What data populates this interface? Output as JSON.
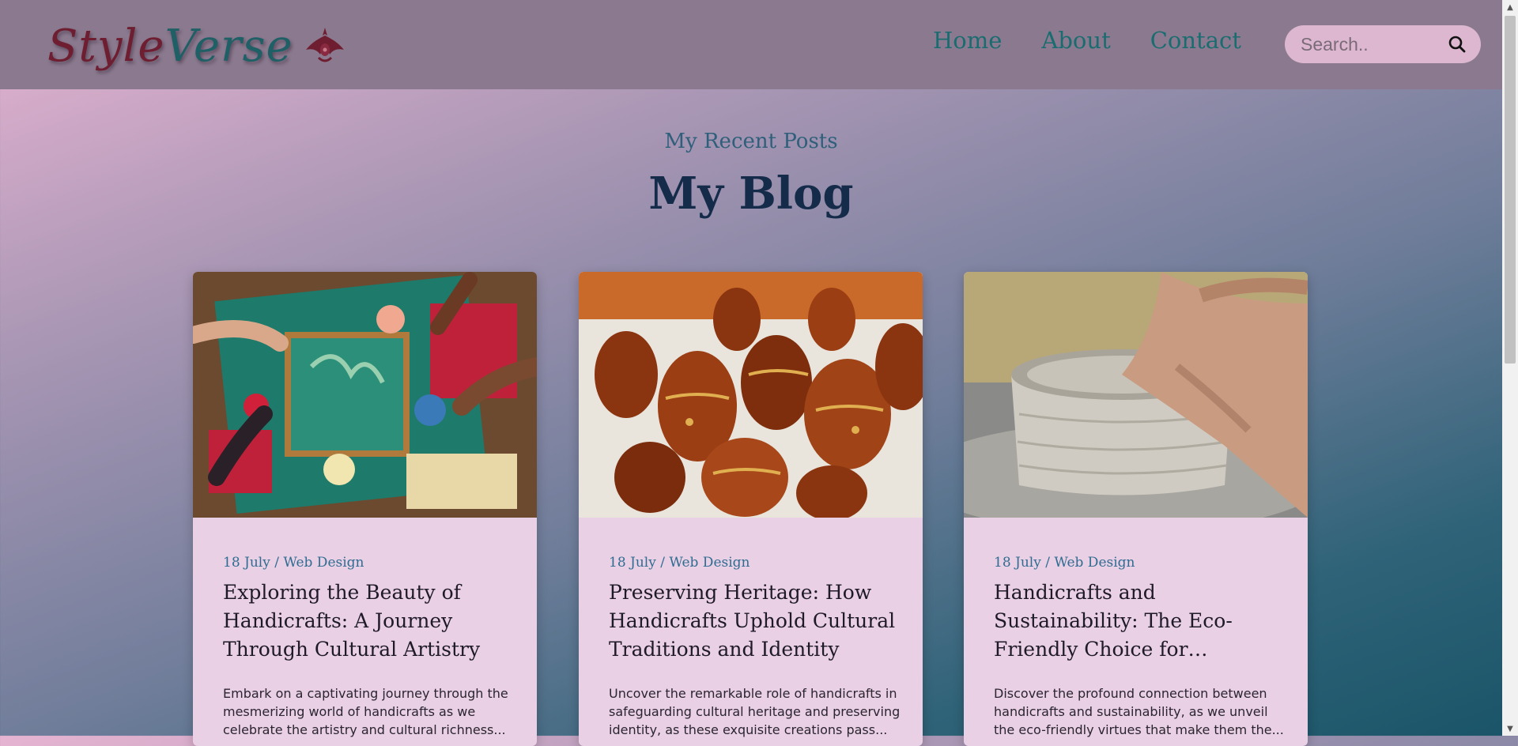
{
  "brand": {
    "logo_part1": "Style",
    "logo_part2": "Verse"
  },
  "nav": {
    "items": [
      "Home",
      "About",
      "Contact"
    ]
  },
  "search": {
    "placeholder": "Search.."
  },
  "section": {
    "subtitle": "My Recent Posts",
    "title": "My Blog"
  },
  "posts": [
    {
      "meta": "18 July / Web Design",
      "title": "Exploring the Beauty of Handicrafts: A Journey Through Cultural Artistry",
      "excerpt": "Embark on a captivating journey through the mesmerizing world of handicrafts as we celebrate the artistry and cultural richness..."
    },
    {
      "meta": "18 July / Web Design",
      "title": "Preserving Heritage: How Handicrafts Uphold Cultural Traditions and Identity",
      "excerpt": "Uncover the remarkable role of handicrafts in safeguarding cultural heritage and preserving identity, as these exquisite creations pass..."
    },
    {
      "meta": "18 July / Web Design",
      "title": "Handicrafts and Sustainability: The Eco-Friendly Choice for Conscious Consumers",
      "excerpt": "Discover the profound connection between handicrafts and sustainability, as we unveil the eco-friendly virtues that make them the..."
    }
  ],
  "colors": {
    "nav_bg": "#8b7a8f",
    "card_bg": "#ead0e4",
    "link": "#1b6c70",
    "logo_maroon": "#6e1e30"
  },
  "icons": {
    "search": "search-icon",
    "logo": "ornament-icon"
  }
}
